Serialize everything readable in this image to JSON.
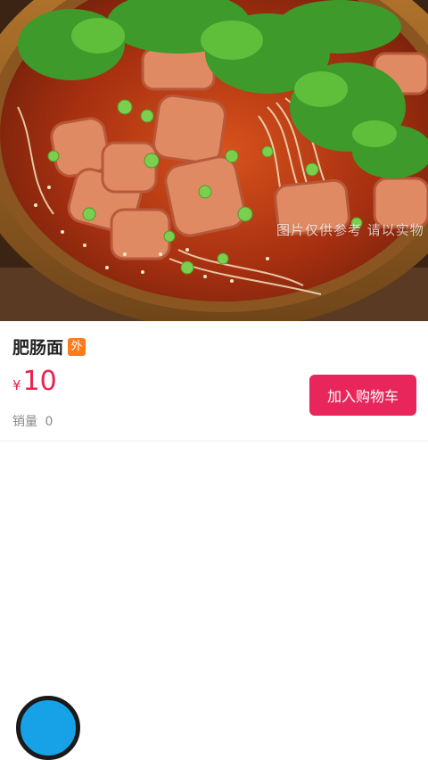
{
  "hero": {
    "image_alt": "noodle bowl photo",
    "watermark": "图片仅供参考 请以实物"
  },
  "product": {
    "name": "肥肠面",
    "badge": "外",
    "currency": "¥",
    "price": "10",
    "sales_label": "销量",
    "sales_count": "0"
  },
  "actions": {
    "add_to_cart": "加入购物车"
  },
  "colors": {
    "accent": "#e8265b",
    "badge": "#ff7a1a",
    "fab": "#17a2e8"
  },
  "icons": {
    "cart_fab": "cart-icon"
  }
}
